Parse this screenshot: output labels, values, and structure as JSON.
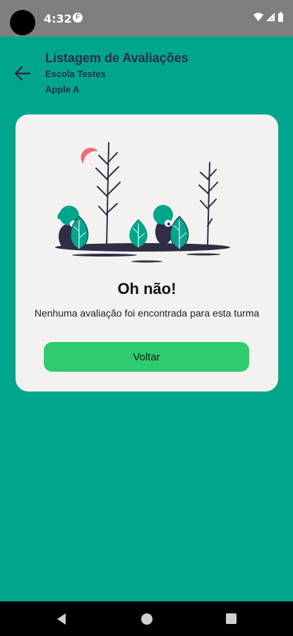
{
  "status_bar": {
    "time": "4:32",
    "app_icon": "F",
    "icons": [
      "wifi-icon",
      "signal-icon",
      "battery-icon"
    ]
  },
  "header": {
    "title": "Listagem de Avaliações",
    "subtitle_school": "Escola Testes",
    "subtitle_class": "Apple A",
    "back_icon": "arrow-left-icon"
  },
  "empty_state": {
    "title": "Oh não!",
    "message": "Nenhuma avaliação foi encontrada para esta turma",
    "button_label": "Voltar",
    "illustration": "characters-hiding-behind-leaves-illustration"
  },
  "nav_bar": {
    "buttons": [
      "nav-back-icon",
      "nav-home-icon",
      "nav-recents-icon"
    ]
  },
  "colors": {
    "background": "#00a68c",
    "card": "#f3f2f0",
    "button": "#2ecc6e",
    "title_text": "#2f2e45",
    "accent_red": "#f06a7a"
  }
}
